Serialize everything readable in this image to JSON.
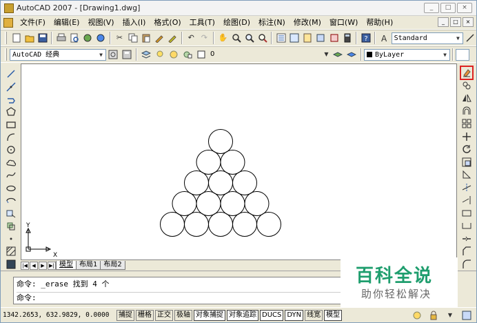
{
  "window": {
    "title": "AutoCAD 2007 - [Drawing1.dwg]",
    "controls": [
      "_",
      "□",
      "×"
    ]
  },
  "menu": {
    "items": [
      "文件(F)",
      "编辑(E)",
      "视图(V)",
      "插入(I)",
      "格式(O)",
      "工具(T)",
      "绘图(D)",
      "标注(N)",
      "修改(M)",
      "窗口(W)",
      "帮助(H)"
    ],
    "mdi_controls": [
      "_",
      "□",
      "×"
    ]
  },
  "toolbar_standard": {
    "text_style": "Standard"
  },
  "toolbar_layers": {
    "workspace": "AutoCAD 经典",
    "layer": "0",
    "color": "ByLayer"
  },
  "layout_tabs": {
    "tabs": [
      "模型",
      "布局1",
      "布局2"
    ],
    "active": "模型"
  },
  "ucs": {
    "x_label": "X",
    "y_label": "Y"
  },
  "command": {
    "lines": [
      "命令: _erase 找到 4 个",
      "命令:"
    ]
  },
  "watermark": {
    "title": "百科全说",
    "subtitle": "助你轻松解决"
  },
  "status": {
    "coords": "1342.2653, 632.9829, 0.0000",
    "toggles": [
      "捕捉",
      "栅格",
      "正交",
      "极轴",
      "对象捕捉",
      "对象追踪",
      "DUCS",
      "DYN",
      "线宽",
      "模型"
    ],
    "on_toggles": [
      "对象捕捉",
      "对象追踪",
      "DUCS",
      "DYN",
      "模型"
    ]
  },
  "colors": {
    "accent": "#1f9e6e",
    "highlight": "#dd2222",
    "canvas": "#ffffff"
  },
  "drawing": {
    "circles_per_row": [
      1,
      2,
      3,
      4,
      5
    ],
    "layout": "triangle-stack"
  }
}
